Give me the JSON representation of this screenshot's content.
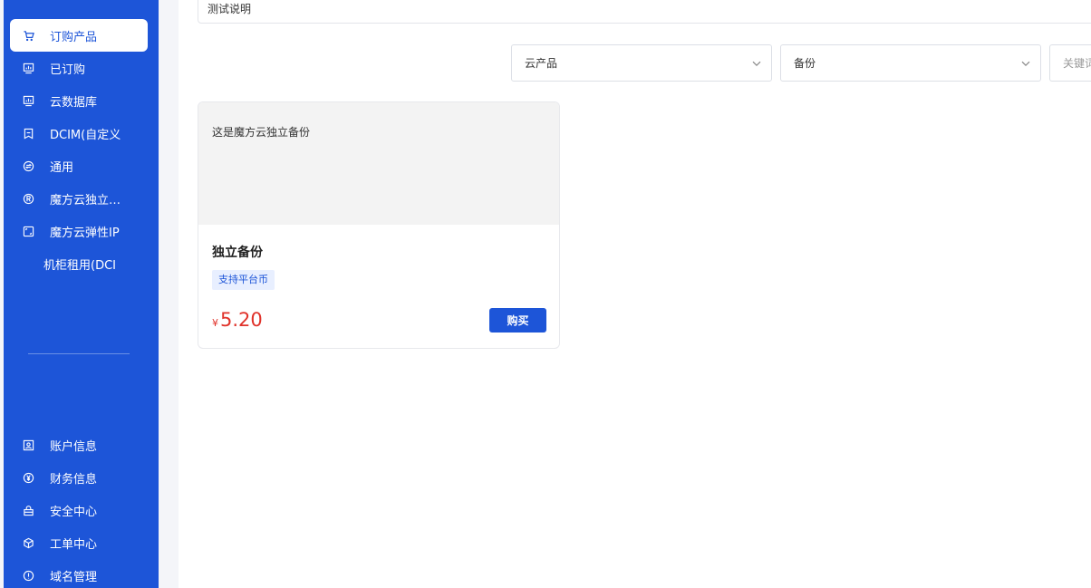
{
  "sidebar": {
    "items": [
      {
        "label": "订购产品",
        "icon": "cart-icon",
        "active": true
      },
      {
        "label": "已订购",
        "icon": "monitor-chart-icon"
      },
      {
        "label": "云数据库",
        "icon": "monitor-chart-icon"
      },
      {
        "label": "DCIM(自定义",
        "icon": "document-icon"
      },
      {
        "label": "通用",
        "icon": "swap-circle-icon"
      },
      {
        "label": "魔方云独立备份",
        "icon": "registered-icon"
      },
      {
        "label": "魔方云弹性IP",
        "icon": "frame-icon"
      },
      {
        "label": "机柜租用(DCI",
        "icon": ""
      }
    ],
    "bottom_items": [
      {
        "label": "账户信息",
        "icon": "user-card-icon"
      },
      {
        "label": "财务信息",
        "icon": "yen-circle-icon"
      },
      {
        "label": "安全中心",
        "icon": "lock-icon"
      },
      {
        "label": "工单中心",
        "icon": "cube-icon"
      },
      {
        "label": "域名管理",
        "icon": "info-circle-icon"
      }
    ]
  },
  "main": {
    "description": "测试说明",
    "filters": {
      "category": "云产品",
      "product": "备份",
      "keyword_placeholder": "关键词"
    },
    "card": {
      "description": "这是魔方云独立备份",
      "title": "独立备份",
      "tag": "支持平台币",
      "currency": "¥",
      "price": "5.20",
      "buy_label": "购买"
    }
  },
  "colors": {
    "primary": "#1d55d8",
    "price": "#e0322a",
    "tag_bg": "#e8efff"
  }
}
